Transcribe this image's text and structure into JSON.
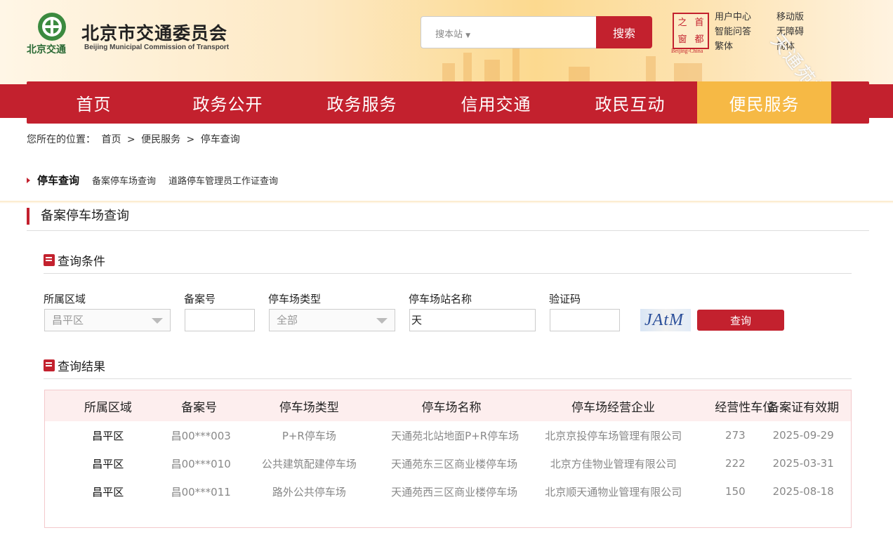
{
  "header": {
    "logo_text": "北京交通",
    "title": "北京市交通委员会",
    "subtitle": "Beijing Municipal Commission of Transport",
    "search_scope": "搜本站",
    "search_button": "搜索",
    "stamp_chars": [
      "首",
      "都",
      "之",
      "窗"
    ],
    "stamp_sub": "Beijing-China",
    "links_col1": [
      "用户中心",
      "智能问答",
      "繁体"
    ],
    "links_col2": [
      "移动版",
      "无障碍",
      "简体"
    ],
    "watermark": "天通苑社区网"
  },
  "nav": {
    "items": [
      {
        "label": "首页",
        "active": false
      },
      {
        "label": "政务公开",
        "active": false
      },
      {
        "label": "政务服务",
        "active": false
      },
      {
        "label": "信用交通",
        "active": false
      },
      {
        "label": "政民互动",
        "active": false
      },
      {
        "label": "便民服务",
        "active": true
      }
    ]
  },
  "breadcrumb": {
    "prefix": "您所在的位置：",
    "items": [
      "首页",
      "便民服务",
      "停车查询"
    ],
    "separator": ">"
  },
  "subnav": {
    "current": "停车查询",
    "links": [
      "备案停车场查询",
      "道路停车管理员工作证查询"
    ]
  },
  "section": {
    "title": "备案停车场查询",
    "conditions_title": "查询条件",
    "results_title": "查询结果"
  },
  "form": {
    "district_label": "所属区域",
    "district_value": "昌平区",
    "record_no_label": "备案号",
    "record_no_value": "",
    "type_label": "停车场类型",
    "type_value": "全部",
    "name_label": "停车场站名称",
    "name_value": "天",
    "captcha_label": "验证码",
    "captcha_value": "",
    "captcha_image_text": "JAtM",
    "query_button": "查询"
  },
  "table": {
    "headers": [
      "所属区域",
      "备案号",
      "停车场类型",
      "停车场名称",
      "停车场经营企业",
      "经营性车位",
      "备案证有效期"
    ],
    "rows": [
      [
        "昌平区",
        "昌00***003",
        "P+R停车场",
        "天通苑北站地面P+R停车场",
        "北京京投停车场管理有限公司",
        "273",
        "2025-09-29"
      ],
      [
        "昌平区",
        "昌00***010",
        "公共建筑配建停车场",
        "天通苑东三区商业楼停车场",
        "北京方佳物业管理有限公司",
        "222",
        "2025-03-31"
      ],
      [
        "昌平区",
        "昌00***011",
        "路外公共停车场",
        "天通苑西三区商业楼停车场",
        "北京顺天通物业管理有限公司",
        "150",
        "2025-08-18"
      ]
    ]
  },
  "colors": {
    "brand_red": "#c3212e",
    "nav_active": "#f6b945"
  }
}
